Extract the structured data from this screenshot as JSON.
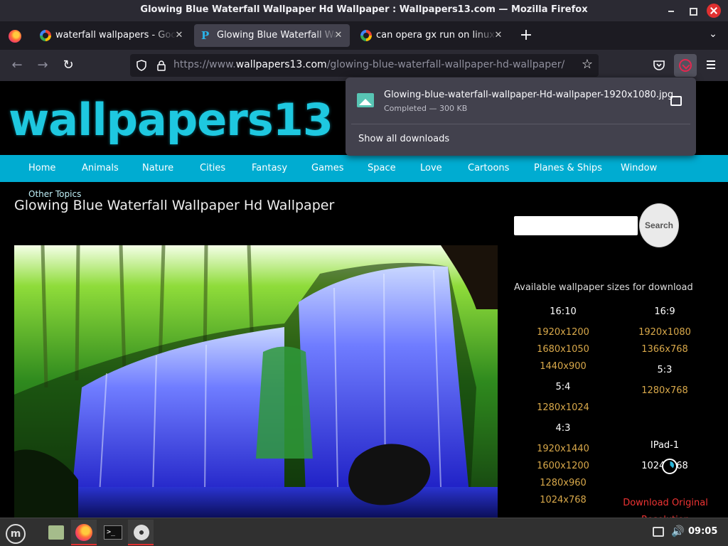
{
  "window": {
    "title": "Glowing Blue Waterfall Wallpaper Hd Wallpaper : Wallpapers13.com — Mozilla Firefox"
  },
  "tabs": [
    {
      "label": "waterfall wallpapers - Google Search",
      "active": false
    },
    {
      "label": "Glowing Blue Waterfall Wallpaper Hd Wallpaper",
      "active": true
    },
    {
      "label": "can opera gx run on linux - Google Search",
      "active": false
    }
  ],
  "urlbar": {
    "prefix": "https://www.",
    "domain": "wallpapers13.com",
    "path": "/glowing-blue-waterfall-wallpaper-hd-wallpaper/"
  },
  "downloads": {
    "file_name": "Glowing-blue-waterfall-wallpaper-Hd-wallpaper-1920x1080.jpg",
    "status": "Completed — 300 KB",
    "show_all": "Show all downloads"
  },
  "site": {
    "logo": "wallpapers13",
    "nav": [
      "Home",
      "Animals",
      "Nature",
      "Cities",
      "Fantasy",
      "Games",
      "Space",
      "Love",
      "Cartoons",
      "Planes & Ships",
      "Window"
    ],
    "other_topics": "Other Topics",
    "page_title": "Glowing Blue Waterfall Wallpaper Hd Wallpaper",
    "search_button": "Search",
    "sizes_title": "Available wallpaper sizes for download",
    "left_groups": [
      {
        "ratio": "16:10",
        "sizes": [
          "1920x1200",
          "1680x1050",
          "1440x900"
        ]
      },
      {
        "ratio": "5:4",
        "sizes": [
          "1280x1024"
        ]
      },
      {
        "ratio": "4:3",
        "sizes": [
          "1920x1440",
          "1600x1200",
          "1280x960",
          "1024x768"
        ]
      }
    ],
    "right_groups": [
      {
        "ratio": "16:9",
        "sizes": [
          "1920x1080",
          "1366x768"
        ]
      },
      {
        "ratio": "5:3",
        "sizes": [
          "1280x768"
        ]
      },
      {
        "ratio": "IPad-1",
        "sizes": [
          "1024x768"
        ]
      }
    ],
    "download_original": "Download Original Resolution"
  },
  "taskbar": {
    "clock": "09:05"
  }
}
